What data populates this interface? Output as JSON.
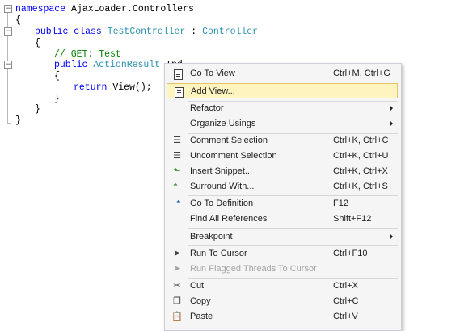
{
  "editor": {
    "lines": [
      [
        "namespace ",
        "AjaxLoader.Controllers"
      ],
      [
        "{"
      ],
      [
        "public class ",
        "TestController",
        " : ",
        "Controller"
      ],
      [
        "{"
      ],
      [
        "// GET: Test"
      ],
      [
        "public ",
        "ActionResult",
        " Ind"
      ],
      [
        "{"
      ],
      [
        "return ",
        "View();"
      ],
      [
        "}"
      ],
      [
        "}"
      ],
      [
        "}"
      ]
    ],
    "fold_glyph": "−"
  },
  "context_menu": {
    "items": [
      {
        "label": "Go To View",
        "shortcut": "Ctrl+M, Ctrl+G",
        "icon": "document-icon"
      },
      {
        "label": "Add View...",
        "shortcut": "",
        "icon": "document-icon",
        "highlighted": true
      },
      {
        "label": "Refactor",
        "shortcut": "",
        "submenu": true
      },
      {
        "label": "Organize Usings",
        "shortcut": "",
        "submenu": true
      },
      {
        "label": "Comment Selection",
        "shortcut": "Ctrl+K, Ctrl+C",
        "icon": "comment-icon"
      },
      {
        "label": "Uncomment Selection",
        "shortcut": "Ctrl+K, Ctrl+U",
        "icon": "uncomment-icon"
      },
      {
        "label": "Insert Snippet...",
        "shortcut": "Ctrl+K, Ctrl+X",
        "icon": "snippet-icon"
      },
      {
        "label": "Surround With...",
        "shortcut": "Ctrl+K, Ctrl+S",
        "icon": "surround-icon"
      },
      {
        "label": "Go To Definition",
        "shortcut": "F12",
        "icon": "goto-definition-icon"
      },
      {
        "label": "Find All References",
        "shortcut": "Shift+F12"
      },
      {
        "label": "Breakpoint",
        "shortcut": "",
        "submenu": true
      },
      {
        "label": "Run To Cursor",
        "shortcut": "Ctrl+F10",
        "icon": "cursor-icon"
      },
      {
        "label": "Run Flagged Threads To Cursor",
        "shortcut": "",
        "icon": "cursor-icon",
        "disabled": true
      },
      {
        "label": "Cut",
        "shortcut": "Ctrl+X",
        "icon": "scissors-icon"
      },
      {
        "label": "Copy",
        "shortcut": "Ctrl+C",
        "icon": "copy-icon"
      },
      {
        "label": "Paste",
        "shortcut": "Ctrl+V",
        "icon": "paste-icon"
      }
    ]
  },
  "colors": {
    "keyword": "#0000ff",
    "type": "#2b91af",
    "comment": "#008000",
    "highlight_bg": "#fdf4bf",
    "highlight_border": "#e5c365",
    "menu_bg": "#f5f5f5"
  }
}
